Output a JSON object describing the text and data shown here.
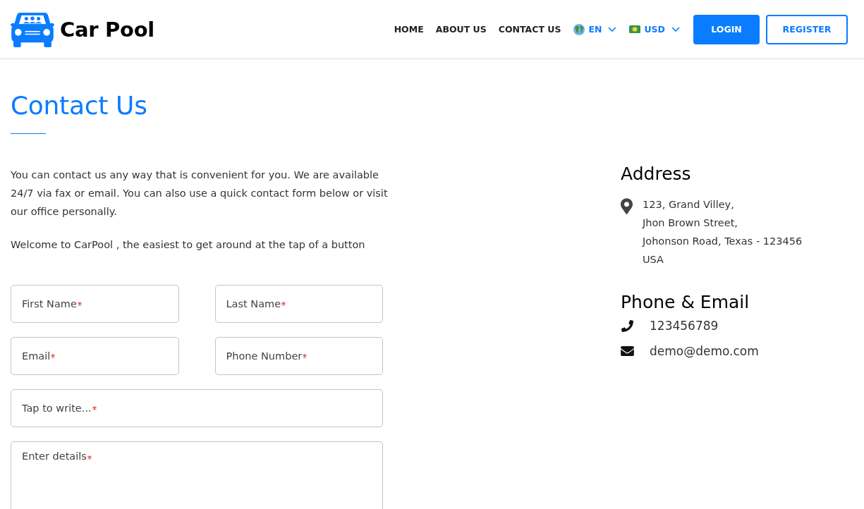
{
  "header": {
    "logo_text": "Car Pool",
    "nav": [
      {
        "label": "HOME"
      },
      {
        "label": "ABOUT US"
      },
      {
        "label": "CONTACT US"
      }
    ],
    "selectors": [
      {
        "kind": "language",
        "label": "EN"
      },
      {
        "kind": "currency",
        "label": "USD"
      }
    ],
    "buttons": [
      {
        "kind": "primary",
        "label": "LOGIN"
      },
      {
        "kind": "outline",
        "label": "REGISTER"
      }
    ]
  },
  "page_title": "Contact Us",
  "intro": [
    "You can contact us any way that is convenient for you. We are available 24/7 via fax or email. You can also use a quick contact form below or visit our office personally.",
    "Welcome to CarPool , the easiest to get around at the tap of a button"
  ],
  "form": {
    "rows": [
      {
        "fields": [
          {
            "kind": "input",
            "placeholder": "First Name",
            "required": true
          },
          {
            "kind": "input",
            "placeholder": "Last Name",
            "required": true
          }
        ]
      },
      {
        "fields": [
          {
            "kind": "input",
            "placeholder": "Email",
            "required": true
          },
          {
            "kind": "input",
            "placeholder": "Phone Number",
            "required": true
          }
        ]
      },
      {
        "fields": [
          {
            "kind": "input",
            "placeholder": "Tap to write...",
            "required": true
          }
        ]
      },
      {
        "fields": [
          {
            "kind": "textarea",
            "placeholder": "Enter details",
            "required": true
          }
        ]
      }
    ]
  },
  "address": {
    "title": "Address",
    "lines": [
      "123, Grand Villey,",
      "Jhon Brown Street,",
      "Johonson Road, Texas - 123456",
      "USA"
    ]
  },
  "contact": {
    "title": "Phone & Email",
    "items": [
      {
        "kind": "phone",
        "text": "123456789"
      },
      {
        "kind": "email",
        "text": "demo@demo.com"
      }
    ]
  }
}
